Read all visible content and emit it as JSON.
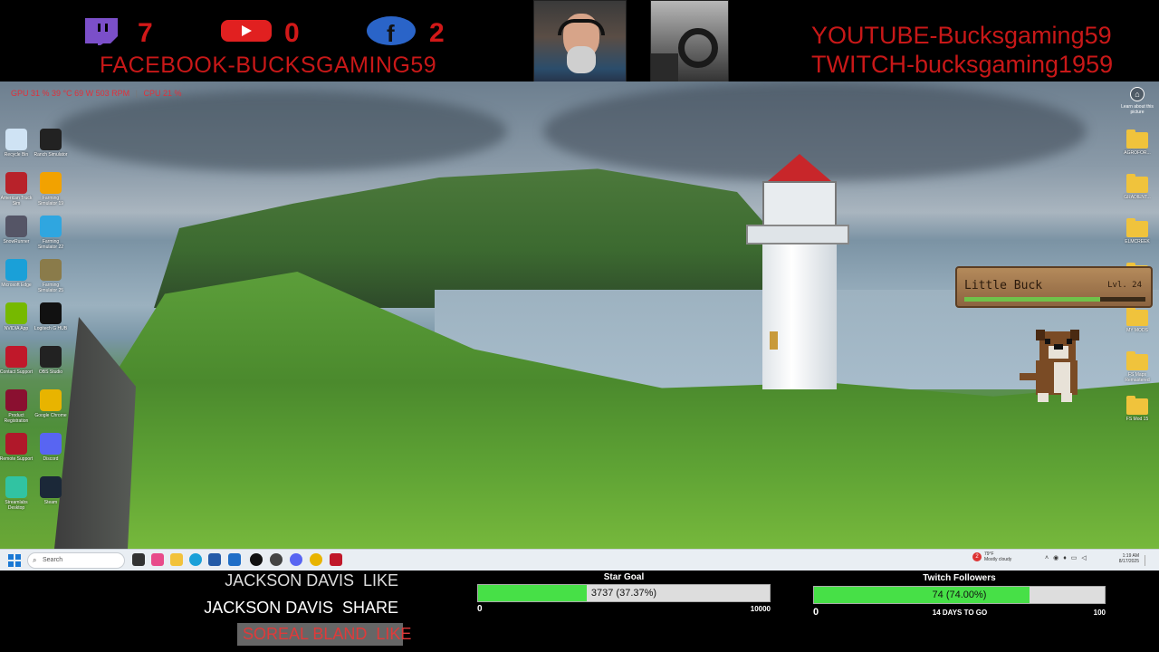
{
  "stream_overlay": {
    "stats": [
      {
        "platform": "twitch",
        "icon": "twitch-icon",
        "count": "7",
        "color": "#7b4fc9"
      },
      {
        "platform": "youtube",
        "icon": "youtube-icon",
        "count": "0",
        "color": "#e12020"
      },
      {
        "platform": "facebook",
        "icon": "facebook-icon",
        "count": "2",
        "color": "#2a64c8"
      }
    ],
    "facebook_handle": "FACEBOOK-BUCKSGAMING59",
    "youtube_handle": "YOUTUBE-Bucksgaming59",
    "twitch_handle": "TWITCH-bucksgaming1959",
    "accent_color": "#c81818"
  },
  "hud": {
    "gpu": "GPU 31 % 39 °C 69 W 503 RPM",
    "cpu": "CPU 21 %"
  },
  "desktop": {
    "left_icons": [
      {
        "label": "Recycle Bin",
        "icon": "recycle-bin-icon",
        "color": "#cfe3f4"
      },
      {
        "label": "Ranch Simulator",
        "icon": "ranch-simulator-icon",
        "color": "#222"
      },
      {
        "label": "American Truck Sim",
        "icon": "american-truck-sim-icon",
        "color": "#b8222a"
      },
      {
        "label": "Farming Simulator 19",
        "icon": "farming-sim-19-icon",
        "color": "#f2a200"
      },
      {
        "label": "SnowRunner",
        "icon": "snowrunner-icon",
        "color": "#556"
      },
      {
        "label": "Farming Simulator 22",
        "icon": "farming-sim-22-icon",
        "color": "#2fa6e0"
      },
      {
        "label": "Microsoft Edge",
        "icon": "edge-icon",
        "color": "#1aa0d8"
      },
      {
        "label": "Farming Simulator 25",
        "icon": "farming-sim-25-icon",
        "color": "#8a7b4a"
      },
      {
        "label": "NVIDIA App",
        "icon": "nvidia-icon",
        "color": "#76b900"
      },
      {
        "label": "Logitech G HUB",
        "icon": "logitech-icon",
        "color": "#111"
      },
      {
        "label": "Contact Support",
        "icon": "contact-support-icon",
        "color": "#c0182a"
      },
      {
        "label": "OBS Studio",
        "icon": "obs-icon",
        "color": "#222"
      },
      {
        "label": "Product Registration",
        "icon": "product-registration-icon",
        "color": "#8a1030"
      },
      {
        "label": "Google Chrome",
        "icon": "chrome-icon",
        "color": "#e8b400"
      },
      {
        "label": "Remote Support",
        "icon": "remote-support-icon",
        "color": "#b0182a"
      },
      {
        "label": "Discord",
        "icon": "discord-icon",
        "color": "#5865f2"
      },
      {
        "label": "Streamlabs Desktop",
        "icon": "streamlabs-icon",
        "color": "#31c3a2"
      },
      {
        "label": "Steam",
        "icon": "steam-icon",
        "color": "#1b2838"
      }
    ],
    "right_icons": [
      {
        "label": "AGROFOR...",
        "icon": "folder-icon"
      },
      {
        "label": "GRADIENT...",
        "icon": "folder-icon"
      },
      {
        "label": "ELMCREEK",
        "icon": "folder-icon"
      },
      {
        "label": "",
        "icon": "folder-icon"
      },
      {
        "label": "MY MODS",
        "icon": "folder-icon"
      },
      {
        "label": "FS Maps Remastered",
        "icon": "folder-icon"
      },
      {
        "label": "FS Mod 15",
        "icon": "folder-icon"
      }
    ],
    "learn_more": "Learn about this picture"
  },
  "pet_widget": {
    "name": "Little Buck",
    "level": "Lvl. 24",
    "xp_fraction": 0.75
  },
  "taskbar": {
    "search_placeholder": "Search",
    "weather_temp": "79°F",
    "weather_desc": "Mostly cloudy",
    "notification_count": "2",
    "time": "1:19 AM",
    "date": "8/17/2025"
  },
  "activity_feed": [
    {
      "text": "JACKSON DAVIS  LIKE"
    },
    {
      "text": "JACKSON DAVIS  SHARE"
    },
    {
      "text": "SOREAL BLAND  LIKE"
    }
  ],
  "star_goal": {
    "title": "Star Goal",
    "current": 3737,
    "target": 10000,
    "label": "3737 (37.37%)",
    "min_label": "0",
    "max_label": "10000"
  },
  "followers_goal": {
    "title": "Twitch Followers",
    "current": 74,
    "target": 100,
    "label": "74 (74.00%)",
    "min_label": "0",
    "max_label": "100",
    "days_label": "14 DAYS TO GO"
  }
}
